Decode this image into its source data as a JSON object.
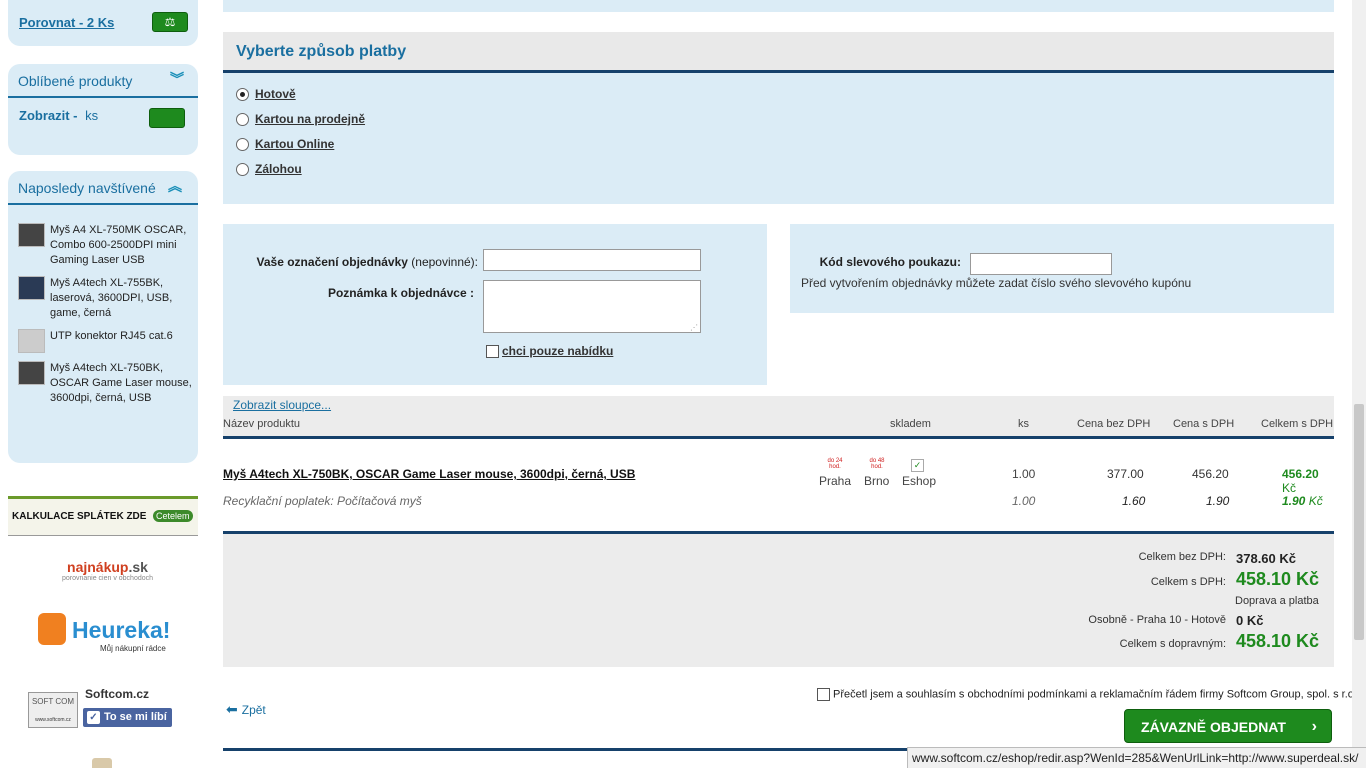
{
  "sidebar": {
    "compare_label": "Porovnat - 2 Ks",
    "favorites_title": "Oblíbené produkty",
    "favorites_show": "Zobrazit -",
    "favorites_unit": "ks",
    "recent_title": "Naposledy navštívené",
    "recent_items": [
      "Myš A4 XL-750MK OSCAR, Combo 600-2500DPI mini Gaming Laser USB",
      "Myš A4tech XL-755BK, laserová, 3600DPI, USB, game, černá",
      "UTP konektor RJ45 cat.6",
      "Myš A4tech XL-750BK, OSCAR Game Laser mouse, 3600dpi, černá, USB"
    ],
    "banners": {
      "kalkulace": "KALKULACE SPLÁTEK ZDE",
      "cetelem": "Cetelem",
      "najnakup": "najnákup",
      "najnakup_sk": ".sk",
      "najnakup_sub": "porovnanie cien v obchodoch",
      "heureka": "Heureka!",
      "heureka_sub": "Můj nákupní rádce",
      "softcom": "Softcom.cz",
      "like": "To se mi líbí",
      "softcom_logo_letters": "SOFT COM",
      "softcom_logo_url": "www.softcom.cz"
    }
  },
  "payment": {
    "title": "Vyberte způsob platby",
    "options": [
      "Hotově",
      "Kartou na prodejně",
      "Kartou Online",
      "Zálohou"
    ],
    "selected": 0
  },
  "order_form": {
    "label_designation": "Vaše označení objednávky",
    "label_optional": "(nepovinné):",
    "label_note": "Poznámka  k objednávce :",
    "offer_only": "chci pouze nabídku",
    "coupon_label": "Kód slevového poukazu:",
    "coupon_hint": "Před vytvořením objednávky můžete zadat číslo svého slevového kupónu"
  },
  "cart": {
    "show_columns": "Zobrazit sloupce...",
    "headers": {
      "name": "Název produktu",
      "stock": "skladem",
      "qty": "ks",
      "price_ex": "Cena bez DPH",
      "price_inc": "Cena s DPH",
      "total_inc": "Celkem s DPH"
    },
    "product": {
      "name": "Myš A4tech XL-750BK, OSCAR Game Laser mouse, 3600dpi, černá, USB",
      "stock_praha_badge": "do 24 hod.",
      "stock_brno_badge": "do 48 hod.",
      "stock_praha": "Praha",
      "stock_brno": "Brno",
      "stock_eshop": "Eshop",
      "qty": "1.00",
      "price_ex": "377.00",
      "price_inc": "456.20",
      "total": "456.20",
      "currency": "Kč"
    },
    "recycling": {
      "name": "Recyklační poplatek: Počítačová myš",
      "qty": "1.00",
      "price_ex": "1.60",
      "price_inc": "1.90",
      "total": "1.90",
      "currency": "Kč"
    }
  },
  "totals": {
    "total_ex_label": "Celkem bez DPH:",
    "total_ex": "378.60 Kč",
    "total_inc_label": "Celkem s DPH:",
    "total_inc": "458.10 Kč",
    "shipping_heading": "Doprava a platba",
    "shipping_label": "Osobně - Praha 10 - Hotově",
    "shipping_value": "0 Kč",
    "grand_label": "Celkem s dopravným:",
    "grand_value": "458.10 Kč"
  },
  "footer": {
    "back": "Zpět",
    "agree": "Přečetl jsem a souhlasím s obchodními podmínkami a reklamačním řádem firmy Softcom Group, spol. s r.o.",
    "order_button": "ZÁVAZNĚ OBJEDNAT",
    "status_url": "www.softcom.cz/eshop/redir.asp?WenId=285&WenUrlLink=http://www.superdeal.sk/"
  }
}
